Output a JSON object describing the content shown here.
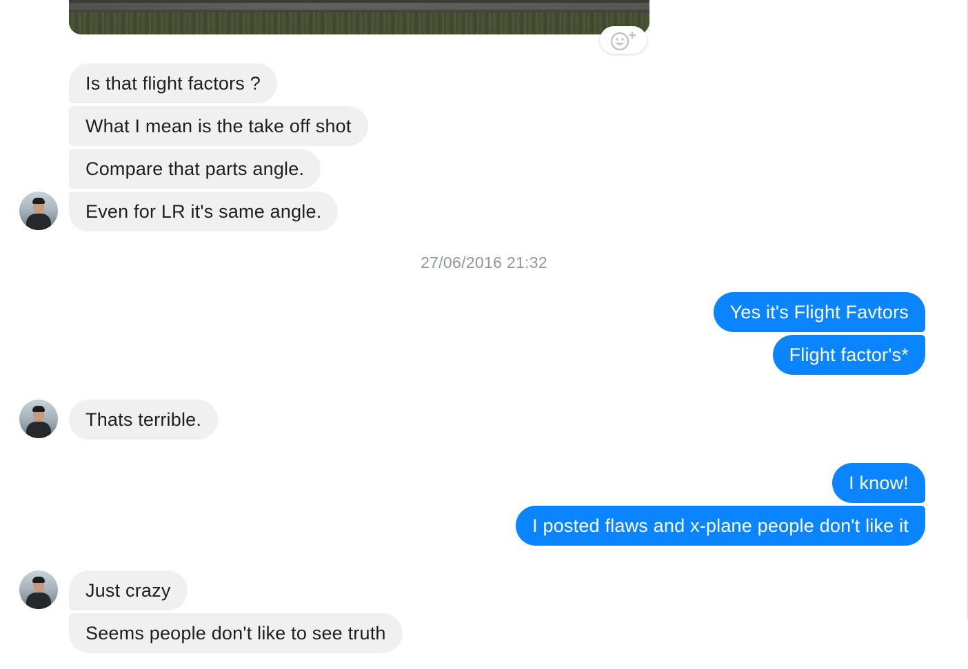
{
  "conversation": {
    "timestamp": "27/06/2016 21:32",
    "messages": [
      {
        "from": "them",
        "text": "Is that flight factors ?"
      },
      {
        "from": "them",
        "text": "What I mean is the take off shot"
      },
      {
        "from": "them",
        "text": "Compare that parts angle."
      },
      {
        "from": "them",
        "text": "Even for LR it's same angle."
      },
      {
        "from": "me",
        "text": "Yes it's Flight Favtors"
      },
      {
        "from": "me",
        "text": "Flight factor's*"
      },
      {
        "from": "them",
        "text": "Thats terrible."
      },
      {
        "from": "me",
        "text": "I know!"
      },
      {
        "from": "me",
        "text": "I posted flaws and x-plane people don't like it"
      },
      {
        "from": "them",
        "text": "Just crazy"
      },
      {
        "from": "them",
        "text": "Seems people don't like to see truth"
      }
    ]
  },
  "icons": {
    "react": "smiley-add-icon",
    "avatar": "contact-avatar"
  },
  "colors": {
    "outgoing_bubble": "#0b84ff",
    "incoming_bubble": "#f1f0f0",
    "timestamp_text": "#90949c"
  }
}
